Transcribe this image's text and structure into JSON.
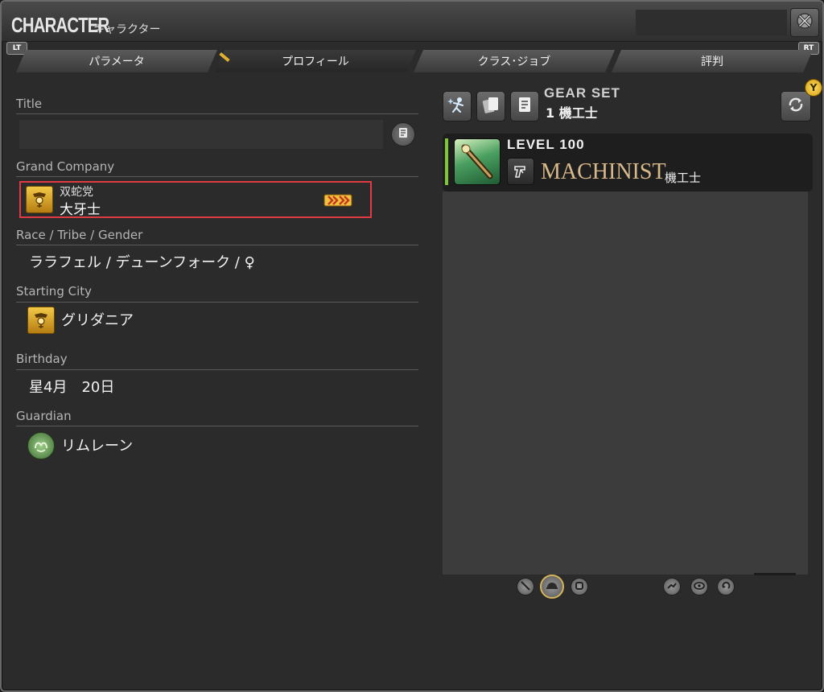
{
  "window": {
    "title": "CHARACTER",
    "subtitle": "キャラクター",
    "close_icon": "gear-close-icon"
  },
  "shoulders": {
    "left": "LT",
    "right": "RT"
  },
  "tabs": [
    {
      "label": "パラメータ",
      "active": false
    },
    {
      "label": "プロフィール",
      "active": true
    },
    {
      "label": "クラス･ジョブ",
      "active": false
    },
    {
      "label": "評判",
      "active": false
    }
  ],
  "profile": {
    "title_label": "Title",
    "title_value": "",
    "grand_company_label": "Grand Company",
    "grand_company_name": "双蛇党",
    "grand_company_rank": "大牙士",
    "race_label": "Race / Tribe / Gender",
    "race_value": "ララフェル / デューンフォーク / ♀",
    "city_label": "Starting City",
    "city_value": "グリダニア",
    "birthday_label": "Birthday",
    "birthday_value": "星4月　20日",
    "guardian_label": "Guardian",
    "guardian_value": "リムレーン"
  },
  "gear": {
    "gearset_label": "GEAR SET",
    "gearset_value": "1 機工士",
    "level_label": "LEVEL 100",
    "level_fill_fraction": 1.0,
    "job_name": "MACHINIST",
    "job_name_jp": "機工士",
    "y_button": "Y"
  },
  "colors": {
    "highlight_border": "#e03a44",
    "job_name": "#d8b98a",
    "level_bar": "#7dc833",
    "emblem_gold": "#f3c948"
  }
}
